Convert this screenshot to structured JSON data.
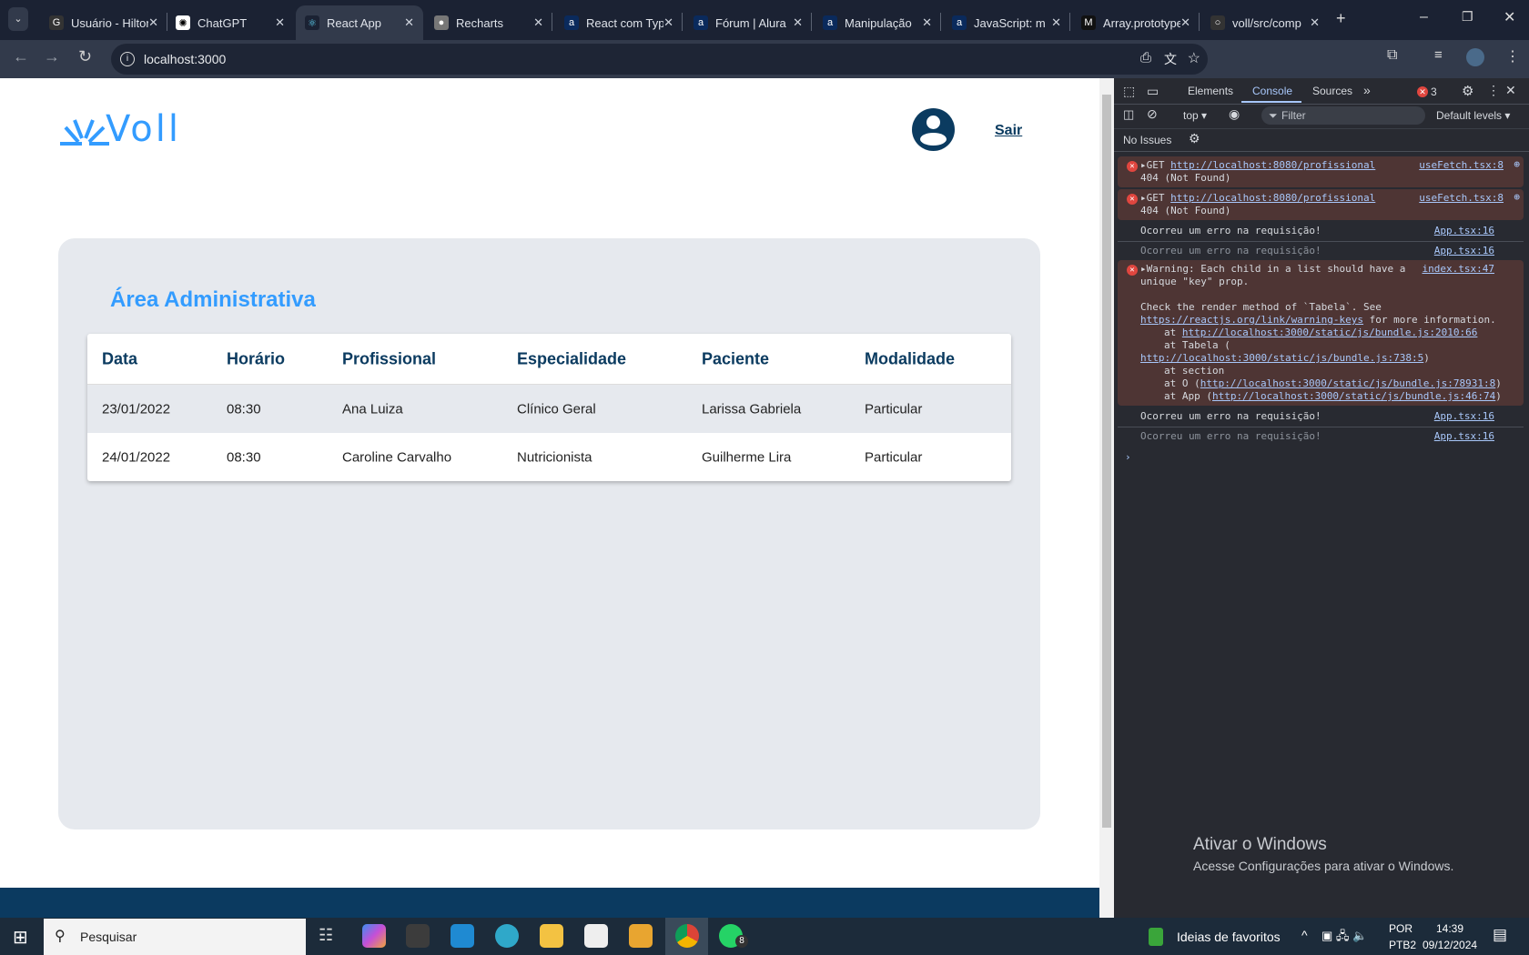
{
  "browser": {
    "tabs": [
      {
        "title": "Usuário - Hilton",
        "icon": "google-icon"
      },
      {
        "title": "ChatGPT",
        "icon": "chatgpt-icon"
      },
      {
        "title": "React App",
        "icon": "react-icon",
        "active": true
      },
      {
        "title": "Recharts",
        "icon": "globe-icon"
      },
      {
        "title": "React com TypeScript",
        "icon": "alura-icon"
      },
      {
        "title": "Fórum | Alura",
        "icon": "alura-icon"
      },
      {
        "title": "Manipulação",
        "icon": "alura-icon"
      },
      {
        "title": "JavaScript: m",
        "icon": "alura-icon"
      },
      {
        "title": "Array.prototype",
        "icon": "mdn-icon"
      },
      {
        "title": "voll/src/comp",
        "icon": "github-icon"
      }
    ],
    "url": "localhost:3000"
  },
  "app": {
    "logo_text": "Voll",
    "logout_label": "Sair",
    "section_title": "Área Administrativa",
    "brand_color": "#339cff",
    "dark_color": "#0b3b60",
    "table": {
      "headers": [
        "Data",
        "Horário",
        "Profissional",
        "Especialidade",
        "Paciente",
        "Modalidade"
      ],
      "rows": [
        [
          "23/01/2022",
          "08:30",
          "Ana Luiza",
          "Clínico Geral",
          "Larissa Gabriela",
          "Particular"
        ],
        [
          "24/01/2022",
          "08:30",
          "Caroline Carvalho",
          "Nutricionista",
          "Guilherme Lira",
          "Particular"
        ]
      ]
    }
  },
  "devtools": {
    "tabs": [
      "Elements",
      "Console",
      "Sources"
    ],
    "active_tab": "Console",
    "error_count": "3",
    "context": "top",
    "filter_placeholder": "Filter",
    "levels": "Default levels",
    "issues": "No Issues",
    "messages": [
      {
        "type": "error",
        "text1": "GET ",
        "link": "http://localhost:8080/profissional",
        "text2": "404 (Not Found)",
        "source": "useFetch.tsx:8"
      },
      {
        "type": "error",
        "text1": "GET ",
        "link": "http://localhost:8080/profissional",
        "text2": "404 (Not Found)",
        "source": "useFetch.tsx:8"
      },
      {
        "type": "log",
        "text": "Ocorreu um erro na requisição!",
        "source": "App.tsx:16"
      },
      {
        "type": "log-faded",
        "text": "Ocorreu um erro na requisição!",
        "source": "App.tsx:16"
      },
      {
        "type": "warning",
        "line1": "Warning: Each child in a list should have a",
        "line2": "unique \"key\" prop.",
        "line3": "Check the render method of `Tabela`. See",
        "link1": "https://reactjs.org/link/warning-keys",
        "line4": " for more information.",
        "at1": "at ",
        "link2": "http://localhost:3000/static/js/bundle.js:2010:66",
        "at2": "at Tabela (",
        "link3": "http://localhost:3000/static/js/bundle.js:738:5",
        "at3": "at section",
        "at4": "at O (",
        "link4": "http://localhost:3000/static/js/bundle.js:78931:8",
        "at5": "at App (",
        "link5": "http://localhost:3000/static/js/bundle.js:46:74",
        "close": ")",
        "source": "index.tsx:47"
      },
      {
        "type": "log",
        "text": "Ocorreu um erro na requisição!",
        "source": "App.tsx:16"
      },
      {
        "type": "log-faded",
        "text": "Ocorreu um erro na requisição!",
        "source": "App.tsx:16"
      }
    ]
  },
  "watermark": {
    "title": "Ativar o Windows",
    "subtitle": "Acesse Configurações para ativar o Windows."
  },
  "taskbar": {
    "search_placeholder": "Pesquisar",
    "widget": "Ideias de favoritos",
    "lang1": "POR",
    "lang2": "PTB2",
    "time": "14:39",
    "date": "09/12/2024",
    "whatsapp_badge": "8"
  }
}
